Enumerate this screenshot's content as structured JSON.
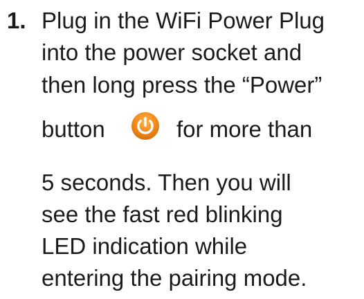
{
  "step": {
    "number": "1.",
    "lines": [
      "Plug in the WiFi Power Plug",
      "into the power socket and",
      "then long press the “Power”",
      "button",
      "5 seconds. Then you will",
      "see the fast red blinking",
      "LED indication while",
      "entering the pairing mode."
    ],
    "after_icon_text": "for more than",
    "icon": {
      "name": "power-icon",
      "color": "#f08a1c"
    }
  }
}
